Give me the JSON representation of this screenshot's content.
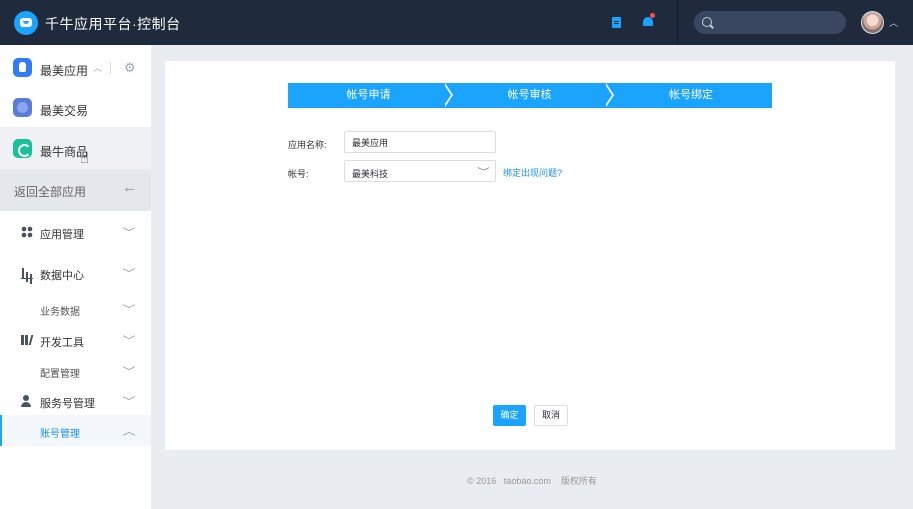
{
  "header": {
    "title": "千牛应用平台·控制台",
    "search_placeholder": "",
    "icons": [
      "logo-icon",
      "document-icon",
      "bell-icon",
      "search-icon",
      "avatar"
    ]
  },
  "sidebar": {
    "apps": [
      {
        "label": "最美应用",
        "icon": "app-icon-blue"
      },
      {
        "label": "最美交易",
        "icon": "app-icon-indigo"
      },
      {
        "label": "最牛商品",
        "icon": "app-icon-green"
      }
    ],
    "back_label": "返回全部应用",
    "nav": [
      {
        "label": "应用管理",
        "icon": "grid-icon"
      },
      {
        "label": "数据中心",
        "icon": "bar-chart-icon"
      },
      {
        "label": "业务数据",
        "sub": true
      },
      {
        "label": "开发工具",
        "icon": "tools-icon"
      },
      {
        "label": "配置管理",
        "sub": true
      },
      {
        "label": "服务号管理",
        "icon": "user-settings-icon"
      },
      {
        "label": "账号管理",
        "sub": true,
        "active": true
      }
    ]
  },
  "main": {
    "steps": [
      "帐号申请",
      "帐号审核",
      "帐号绑定"
    ],
    "form": {
      "app_name_label": "应用名称:",
      "app_name_value": "最美应用",
      "account_label": "帐号:",
      "account_value": "最美科技",
      "help_link": "绑定出现问题?"
    },
    "buttons": {
      "confirm": "确定",
      "cancel": "取消"
    }
  },
  "footer": {
    "text": "© 2016   taobao.com    版权所有"
  },
  "colors": {
    "topbar": "#1f2a3c",
    "accent": "#1aa3ff",
    "background": "#e9ecf0"
  }
}
